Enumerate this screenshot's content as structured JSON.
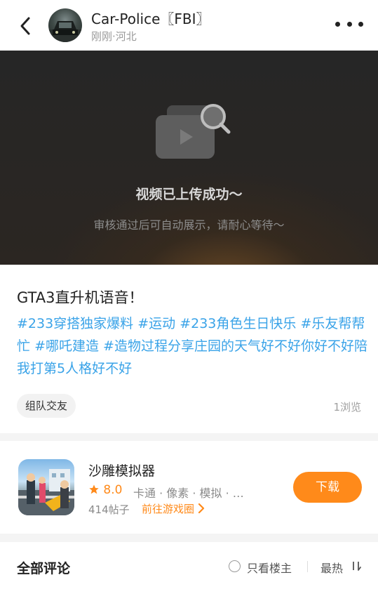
{
  "header": {
    "username": "Car-Police〖FBI〗",
    "time": "刚刚",
    "location": "河北",
    "separator": "·"
  },
  "video": {
    "status_title": "视频已上传成功～",
    "status_sub": "审核通过后可自动展示，请耐心等待～"
  },
  "post": {
    "title": "GTA3直升机语音！",
    "tags": [
      "#233穿搭独家爆料",
      "#运动",
      "#233角色生日快乐",
      "#乐友帮帮忙",
      "#哪吒建造",
      "#造物过程分享庄园的天气好不好你好不好陪我打第5人格好不好"
    ],
    "group_chip": "组队交友",
    "views": "1浏览"
  },
  "game": {
    "name": "沙雕模拟器",
    "rating": "8.0",
    "tags": "卡通 · 像素 · 模拟 · …",
    "posts": "414帖子",
    "link": "前往游戏圈",
    "download": "下载"
  },
  "comments": {
    "title": "全部评论",
    "only_op": "只看楼主",
    "sort": "最热"
  },
  "colors": {
    "accent": "#ff8a1a",
    "tag_blue": "#3aa3e8"
  },
  "icons": {
    "back": "back-arrow-icon",
    "more": "more-dots-icon",
    "video_placeholder": "video-search-icon",
    "star": "star-icon",
    "chevron": "chevron-right-icon",
    "sort": "sort-icon"
  }
}
